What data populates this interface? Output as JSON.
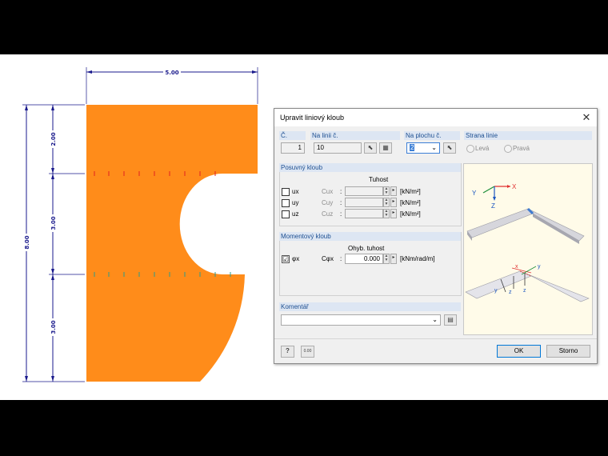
{
  "drawing": {
    "dimensions": {
      "top": "5.00",
      "left_total": "8.00",
      "seg1": "2.00",
      "seg2": "3.00",
      "seg3": "3.00"
    },
    "colors": {
      "surface": "#ff8c1a",
      "dimension": "#1a1a8c",
      "hinge_red": "#e02020",
      "hinge_teal": "#2a9d8f"
    }
  },
  "dialog": {
    "title": "Upravit liniový kloub",
    "close_glyph": "✕",
    "no": {
      "label": "Č.",
      "value": "1"
    },
    "line": {
      "label": "Na linii č.",
      "value": "10"
    },
    "surface": {
      "label": "Na plochu č.",
      "value": "2"
    },
    "side": {
      "label": "Strana linie",
      "left": "Levá",
      "right": "Pravá"
    },
    "translational": {
      "title": "Posuvný kloub",
      "stiffness_header": "Tuhost",
      "rows": [
        {
          "dof": "ux",
          "param": "Cux",
          "sep": ":",
          "unit": "[kN/m²]"
        },
        {
          "dof": "uy",
          "param": "Cuy",
          "sep": ":",
          "unit": "[kN/m²]"
        },
        {
          "dof": "uz",
          "param": "Cuz",
          "sep": ":",
          "unit": "[kN/m²]"
        }
      ]
    },
    "rotational": {
      "title": "Momentový kloub",
      "header": "Ohyb. tuhost",
      "dof": "φx",
      "param": "Cφx",
      "sep": ":",
      "value": "0.000",
      "unit": "[kNm/rad/m]",
      "checked_glyph": "☑"
    },
    "comment": {
      "title": "Komentář",
      "value": ""
    },
    "ok": "OK",
    "cancel": "Storno",
    "help_glyph": "?",
    "calc_glyph": "0.00",
    "axes": {
      "x": "X",
      "y": "Y",
      "z": "Z",
      "lx": "x",
      "ly": "y",
      "lz": "z"
    }
  }
}
